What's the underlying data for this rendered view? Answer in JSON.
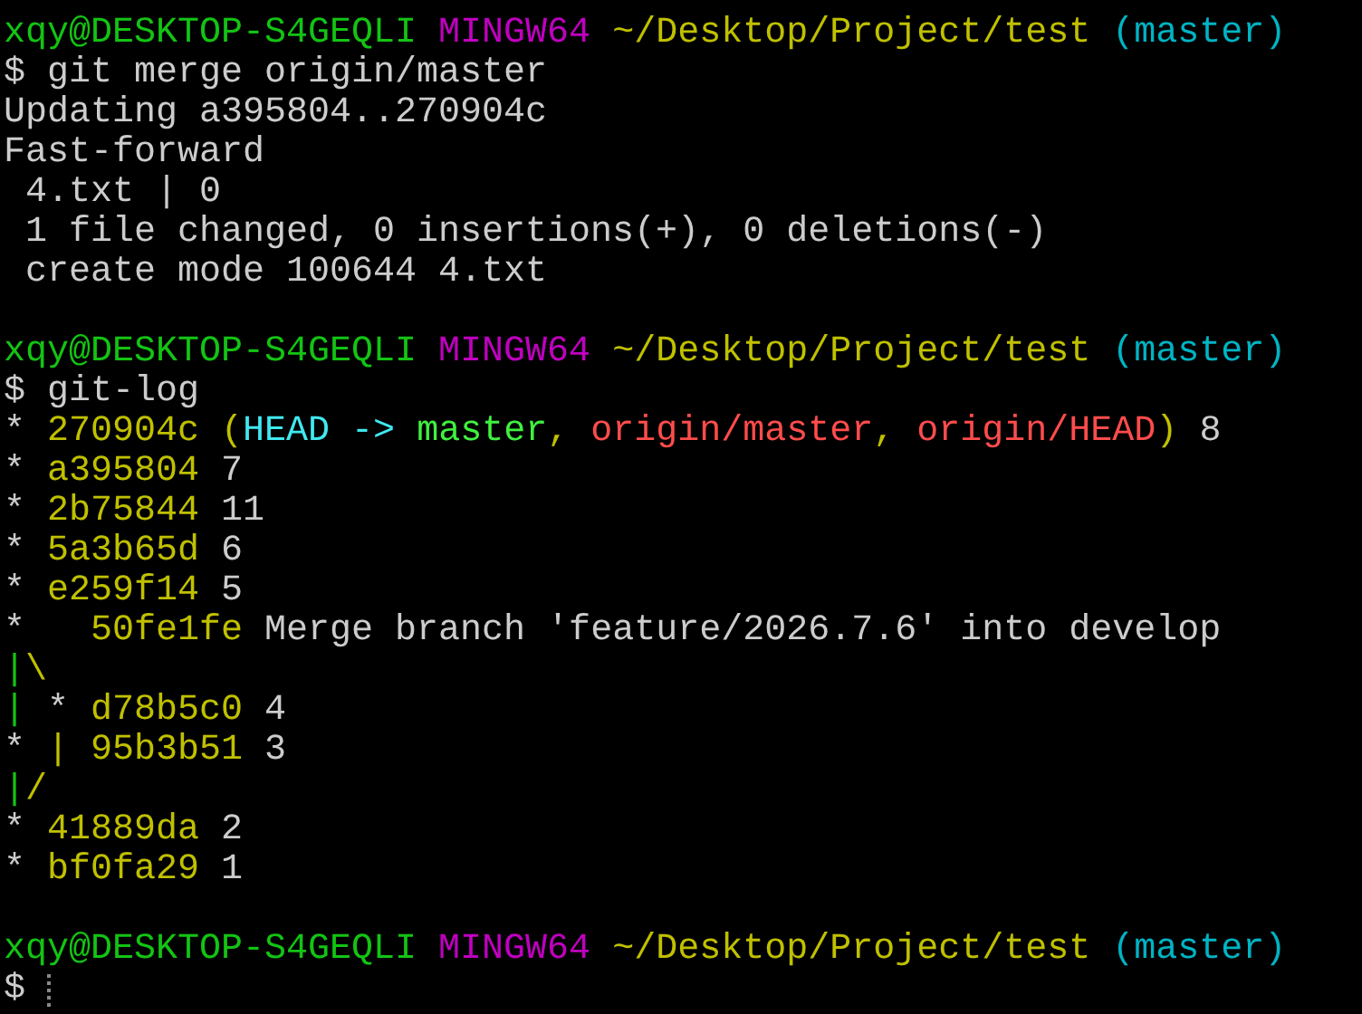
{
  "terminal": {
    "cursor_visible": true,
    "blocks": [
      {
        "lines": [
          {
            "segments": [
              {
                "text": "xqy@DESKTOP-S4GEQLI ",
                "color": "#13c413"
              },
              {
                "text": "MINGW64 ",
                "color": "#c000c0"
              },
              {
                "text": "~/Desktop/Project/test ",
                "color": "#c0c000"
              },
              {
                "text": "(master)",
                "color": "#00b4c4"
              }
            ]
          },
          {
            "segments": [
              {
                "text": "$ git merge origin/master",
                "color": "#cccccc"
              }
            ]
          },
          {
            "segments": [
              {
                "text": "Updating a395804..270904c",
                "color": "#cccccc"
              }
            ]
          },
          {
            "segments": [
              {
                "text": "Fast-forward",
                "color": "#cccccc"
              }
            ]
          },
          {
            "segments": [
              {
                "text": " 4.txt | 0",
                "color": "#cccccc"
              }
            ]
          },
          {
            "segments": [
              {
                "text": " 1 file changed, 0 insertions(+), 0 deletions(-)",
                "color": "#cccccc"
              }
            ]
          },
          {
            "segments": [
              {
                "text": " create mode 100644 4.txt",
                "color": "#cccccc"
              }
            ]
          }
        ]
      },
      {
        "lines": [
          {
            "segments": [
              {
                "text": "xqy@DESKTOP-S4GEQLI ",
                "color": "#13c413"
              },
              {
                "text": "MINGW64 ",
                "color": "#c000c0"
              },
              {
                "text": "~/Desktop/Project/test ",
                "color": "#c0c000"
              },
              {
                "text": "(master)",
                "color": "#00b4c4"
              }
            ]
          },
          {
            "segments": [
              {
                "text": "$ git-log",
                "color": "#cccccc"
              }
            ]
          },
          {
            "segments": [
              {
                "text": "* ",
                "color": "#cccccc"
              },
              {
                "text": "270904c (",
                "color": "#c0c000"
              },
              {
                "text": "HEAD -> ",
                "color": "#40e8f0"
              },
              {
                "text": "master",
                "color": "#40f040"
              },
              {
                "text": ", ",
                "color": "#c0c000"
              },
              {
                "text": "origin/master",
                "color": "#ff4c4c"
              },
              {
                "text": ", ",
                "color": "#c0c000"
              },
              {
                "text": "origin/HEAD",
                "color": "#ff4c4c"
              },
              {
                "text": ")",
                "color": "#c0c000"
              },
              {
                "text": " 8",
                "color": "#cccccc"
              }
            ]
          },
          {
            "segments": [
              {
                "text": "* ",
                "color": "#cccccc"
              },
              {
                "text": "a395804",
                "color": "#c0c000"
              },
              {
                "text": " 7",
                "color": "#cccccc"
              }
            ]
          },
          {
            "segments": [
              {
                "text": "* ",
                "color": "#cccccc"
              },
              {
                "text": "2b75844",
                "color": "#c0c000"
              },
              {
                "text": " 11",
                "color": "#cccccc"
              }
            ]
          },
          {
            "segments": [
              {
                "text": "* ",
                "color": "#cccccc"
              },
              {
                "text": "5a3b65d",
                "color": "#c0c000"
              },
              {
                "text": " 6",
                "color": "#cccccc"
              }
            ]
          },
          {
            "segments": [
              {
                "text": "* ",
                "color": "#cccccc"
              },
              {
                "text": "e259f14",
                "color": "#c0c000"
              },
              {
                "text": " 5",
                "color": "#cccccc"
              }
            ]
          },
          {
            "segments": [
              {
                "text": "*   ",
                "color": "#cccccc"
              },
              {
                "text": "50fe1fe",
                "color": "#c0c000"
              },
              {
                "text": " Merge branch 'feature/2026.7.6' into develop",
                "color": "#cccccc"
              }
            ]
          },
          {
            "segments": [
              {
                "text": "|",
                "color": "#13c413"
              },
              {
                "text": "\\",
                "color": "#c0c000"
              }
            ]
          },
          {
            "segments": [
              {
                "text": "| ",
                "color": "#13c413"
              },
              {
                "text": "* ",
                "color": "#cccccc"
              },
              {
                "text": "d78b5c0",
                "color": "#c0c000"
              },
              {
                "text": " 4",
                "color": "#cccccc"
              }
            ]
          },
          {
            "segments": [
              {
                "text": "* ",
                "color": "#cccccc"
              },
              {
                "text": "| ",
                "color": "#c0c000"
              },
              {
                "text": "95b3b51",
                "color": "#c0c000"
              },
              {
                "text": " 3",
                "color": "#cccccc"
              }
            ]
          },
          {
            "segments": [
              {
                "text": "|",
                "color": "#13c413"
              },
              {
                "text": "/",
                "color": "#c0c000"
              }
            ]
          },
          {
            "segments": [
              {
                "text": "* ",
                "color": "#cccccc"
              },
              {
                "text": "41889da",
                "color": "#c0c000"
              },
              {
                "text": " 2",
                "color": "#cccccc"
              }
            ]
          },
          {
            "segments": [
              {
                "text": "* ",
                "color": "#cccccc"
              },
              {
                "text": "bf0fa29",
                "color": "#c0c000"
              },
              {
                "text": " 1",
                "color": "#cccccc"
              }
            ]
          }
        ]
      },
      {
        "lines": [
          {
            "segments": [
              {
                "text": "xqy@DESKTOP-S4GEQLI ",
                "color": "#13c413"
              },
              {
                "text": "MINGW64 ",
                "color": "#c000c0"
              },
              {
                "text": "~/Desktop/Project/test ",
                "color": "#c0c000"
              },
              {
                "text": "(master)",
                "color": "#00b4c4"
              }
            ]
          },
          {
            "segments": [
              {
                "text": "$ ",
                "color": "#cccccc"
              }
            ]
          }
        ]
      }
    ]
  }
}
